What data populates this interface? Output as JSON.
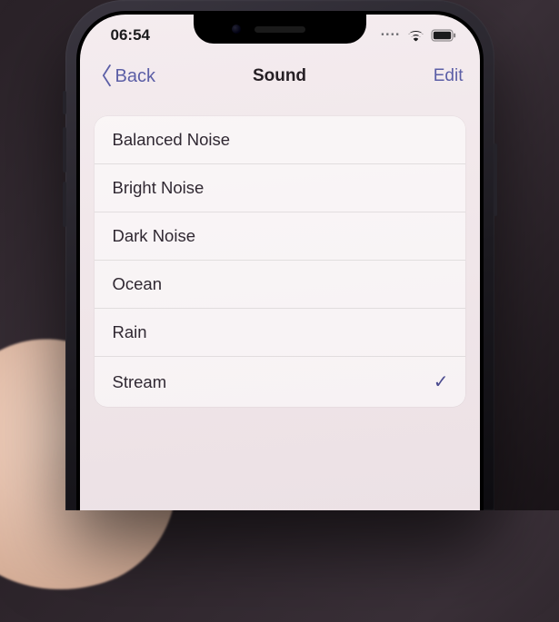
{
  "status": {
    "time": "06:54"
  },
  "nav": {
    "back": "Back",
    "title": "Sound",
    "edit": "Edit"
  },
  "sounds": [
    {
      "label": "Balanced Noise",
      "selected": false
    },
    {
      "label": "Bright Noise",
      "selected": false
    },
    {
      "label": "Dark Noise",
      "selected": false
    },
    {
      "label": "Ocean",
      "selected": false
    },
    {
      "label": "Rain",
      "selected": false
    },
    {
      "label": "Stream",
      "selected": true
    }
  ],
  "colors": {
    "accent": "#5b5ea6",
    "bg": "#f1e7ea"
  }
}
